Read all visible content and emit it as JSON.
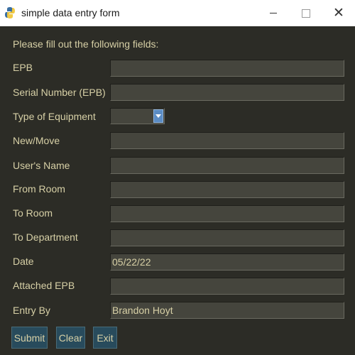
{
  "window": {
    "title": "simple data entry form",
    "app_icon": "python-icon",
    "controls": {
      "minimize": "minimize-icon",
      "maximize": "maximize-icon",
      "close": "close-icon"
    }
  },
  "form": {
    "heading": "Please fill out the following fields:",
    "fields": [
      {
        "label": "EPB",
        "value": ""
      },
      {
        "label": "Serial Number (EPB)",
        "value": ""
      },
      {
        "label": "Type of Equipment",
        "value": ""
      },
      {
        "label": "New/Move",
        "value": ""
      },
      {
        "label": "User's Name",
        "value": ""
      },
      {
        "label": "From Room",
        "value": ""
      },
      {
        "label": "To Room",
        "value": ""
      },
      {
        "label": "To Department",
        "value": ""
      },
      {
        "label": "Date",
        "value": "05/22/22"
      },
      {
        "label": "Attached EPB",
        "value": ""
      },
      {
        "label": "Entry By",
        "value": "Brandon Hoyt"
      }
    ]
  },
  "buttons": {
    "submit": "Submit",
    "clear": "Clear",
    "exit": "Exit"
  },
  "colors": {
    "background": "#2c2c26",
    "text": "#d7d0a6",
    "input": "#45453d",
    "button": "#284b5c",
    "combo_arrow": "#5b8cc4"
  }
}
